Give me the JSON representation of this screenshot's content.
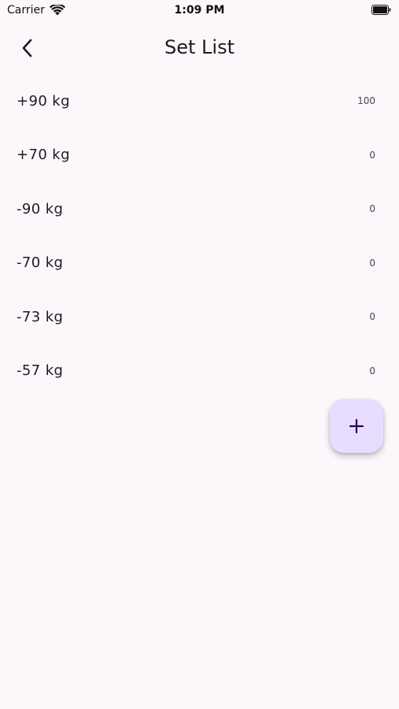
{
  "status_bar": {
    "carrier": "Carrier",
    "time": "1:09 PM",
    "icons": [
      "wifi-icon",
      "battery-icon"
    ]
  },
  "header": {
    "title": "Set List",
    "back_icon": "chevron-left-icon"
  },
  "sets": [
    {
      "weight": "+90 kg",
      "count": "100"
    },
    {
      "weight": "+70 kg",
      "count": "0"
    },
    {
      "weight": "-90 kg",
      "count": "0"
    },
    {
      "weight": "-70 kg",
      "count": "0"
    },
    {
      "weight": "-73 kg",
      "count": "0"
    },
    {
      "weight": "-57 kg",
      "count": "0"
    }
  ],
  "fab": {
    "icon": "plus-icon"
  },
  "colors": {
    "background": "#fdf7fc",
    "fab_background": "#e9ddff",
    "fab_icon": "#21005d",
    "text_primary": "#1d1b20"
  }
}
